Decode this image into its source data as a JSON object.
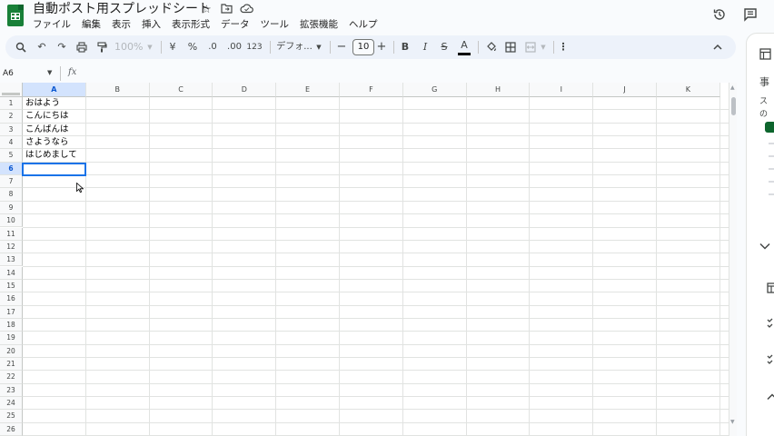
{
  "header": {
    "title": "自動ポスト用スプレッドシート",
    "icons": [
      "star-icon",
      "move-folder-icon",
      "cloud-status-icon",
      "history-icon",
      "comments-icon"
    ]
  },
  "menubar": [
    "ファイル",
    "編集",
    "表示",
    "挿入",
    "表示形式",
    "データ",
    "ツール",
    "拡張機能",
    "ヘルプ"
  ],
  "toolbar": {
    "zoom": "100%",
    "currency": "¥",
    "percent": "%",
    "decrease_decimal": ".0",
    "increase_decimal": ".00",
    "number_format": "123",
    "font": "デフォ...",
    "font_size": "10",
    "bold": "B",
    "italic": "I",
    "strike": "S",
    "text_color": "A"
  },
  "formula_bar": {
    "name_box": "A6",
    "fx": "fx"
  },
  "sheet": {
    "columns": [
      "A",
      "B",
      "C",
      "D",
      "E",
      "F",
      "G",
      "H",
      "I",
      "J",
      "K"
    ],
    "selected_column": "A",
    "rows": [
      "1",
      "2",
      "3",
      "4",
      "5",
      "6",
      "7",
      "8",
      "9",
      "10",
      "11",
      "12",
      "13",
      "14",
      "15",
      "16",
      "17",
      "18",
      "19",
      "20",
      "21",
      "22",
      "23",
      "24",
      "25",
      "26"
    ],
    "selected_row": "6",
    "cells": [
      {
        "ref": "A1",
        "value": "おはよう"
      },
      {
        "ref": "A2",
        "value": "こんにちは"
      },
      {
        "ref": "A3",
        "value": "こんばんは"
      },
      {
        "ref": "A4",
        "value": "さようなら"
      },
      {
        "ref": "A5",
        "value": "はじめまして"
      }
    ],
    "active_cell": "A6"
  },
  "side_panel": {
    "items": [
      "事",
      "ス",
      "の"
    ]
  },
  "colors": {
    "accent": "#1a73e8",
    "toolbar_bg": "#edf2fa",
    "sheets_green": "#188038",
    "selection_header": "#d3e3fd"
  }
}
